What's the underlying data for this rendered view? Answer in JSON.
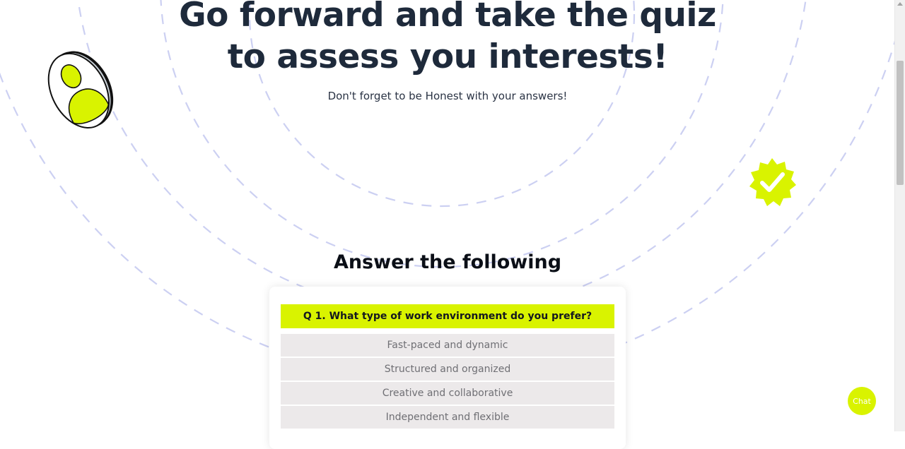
{
  "hero": {
    "title_line1": "Go forward and take the quiz",
    "title_line2": "to assess you interests!",
    "subtitle": "Don't forget to be Honest with your answers!"
  },
  "section": {
    "title": "Answer the following"
  },
  "quiz": {
    "question": "Q 1. What type of work environment do you prefer?",
    "options": [
      "Fast-paced and dynamic",
      "Structured and organized",
      "Creative and collaborative",
      "Independent and flexible"
    ]
  },
  "chat": {
    "label": "Chat"
  },
  "icons": {
    "avatar": "user-avatar-icon",
    "badge": "verified-badge-icon"
  },
  "colors": {
    "accent": "#d9f300",
    "heading": "#1e2a3b",
    "option_bg": "#ece9ea",
    "option_text": "#6f6f74",
    "rings": "#c9cdf1"
  }
}
